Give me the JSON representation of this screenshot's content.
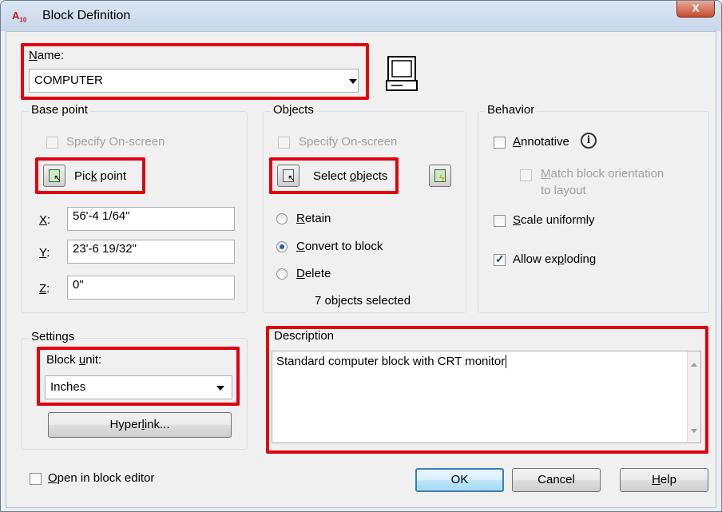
{
  "window": {
    "title": "Block Definition",
    "app_icon": "A",
    "app_icon_sub": "10",
    "close_label": "X"
  },
  "name": {
    "label": "Name:",
    "value": "COMPUTER"
  },
  "base_point": {
    "title": "Base point",
    "specify_label": "Specify On-screen",
    "pick_label": "Pick point",
    "x_label": "X:",
    "x_value": "56'-4 1/64\"",
    "y_label": "Y:",
    "y_value": "23'-6 19/32\"",
    "z_label": "Z:",
    "z_value": "0\""
  },
  "objects": {
    "title": "Objects",
    "specify_label": "Specify On-screen",
    "select_label": "Select objects",
    "retain_label": "Retain",
    "convert_label": "Convert to block",
    "delete_label": "Delete",
    "selected_count_text": "7 objects selected",
    "selected_option": "convert"
  },
  "behavior": {
    "title": "Behavior",
    "annotative_label": "Annotative",
    "annotative_checked": false,
    "match_label_line1": "Match block orientation",
    "match_label_line2": "to layout",
    "scale_label": "Scale uniformly",
    "scale_checked": false,
    "explode_label": "Allow exploding",
    "explode_checked": true
  },
  "settings": {
    "title": "Settings",
    "unit_label": "Block unit:",
    "unit_value": "Inches",
    "hyperlink_label": "Hyperlink..."
  },
  "description": {
    "title": "Description",
    "value": "Standard computer block with CRT monitor"
  },
  "footer": {
    "open_editor_label": "Open in block editor",
    "ok_label": "OK",
    "cancel_label": "Cancel",
    "help_label": "Help"
  },
  "colors": {
    "highlight": "#e3000f",
    "accent": "#3c7fb1"
  }
}
